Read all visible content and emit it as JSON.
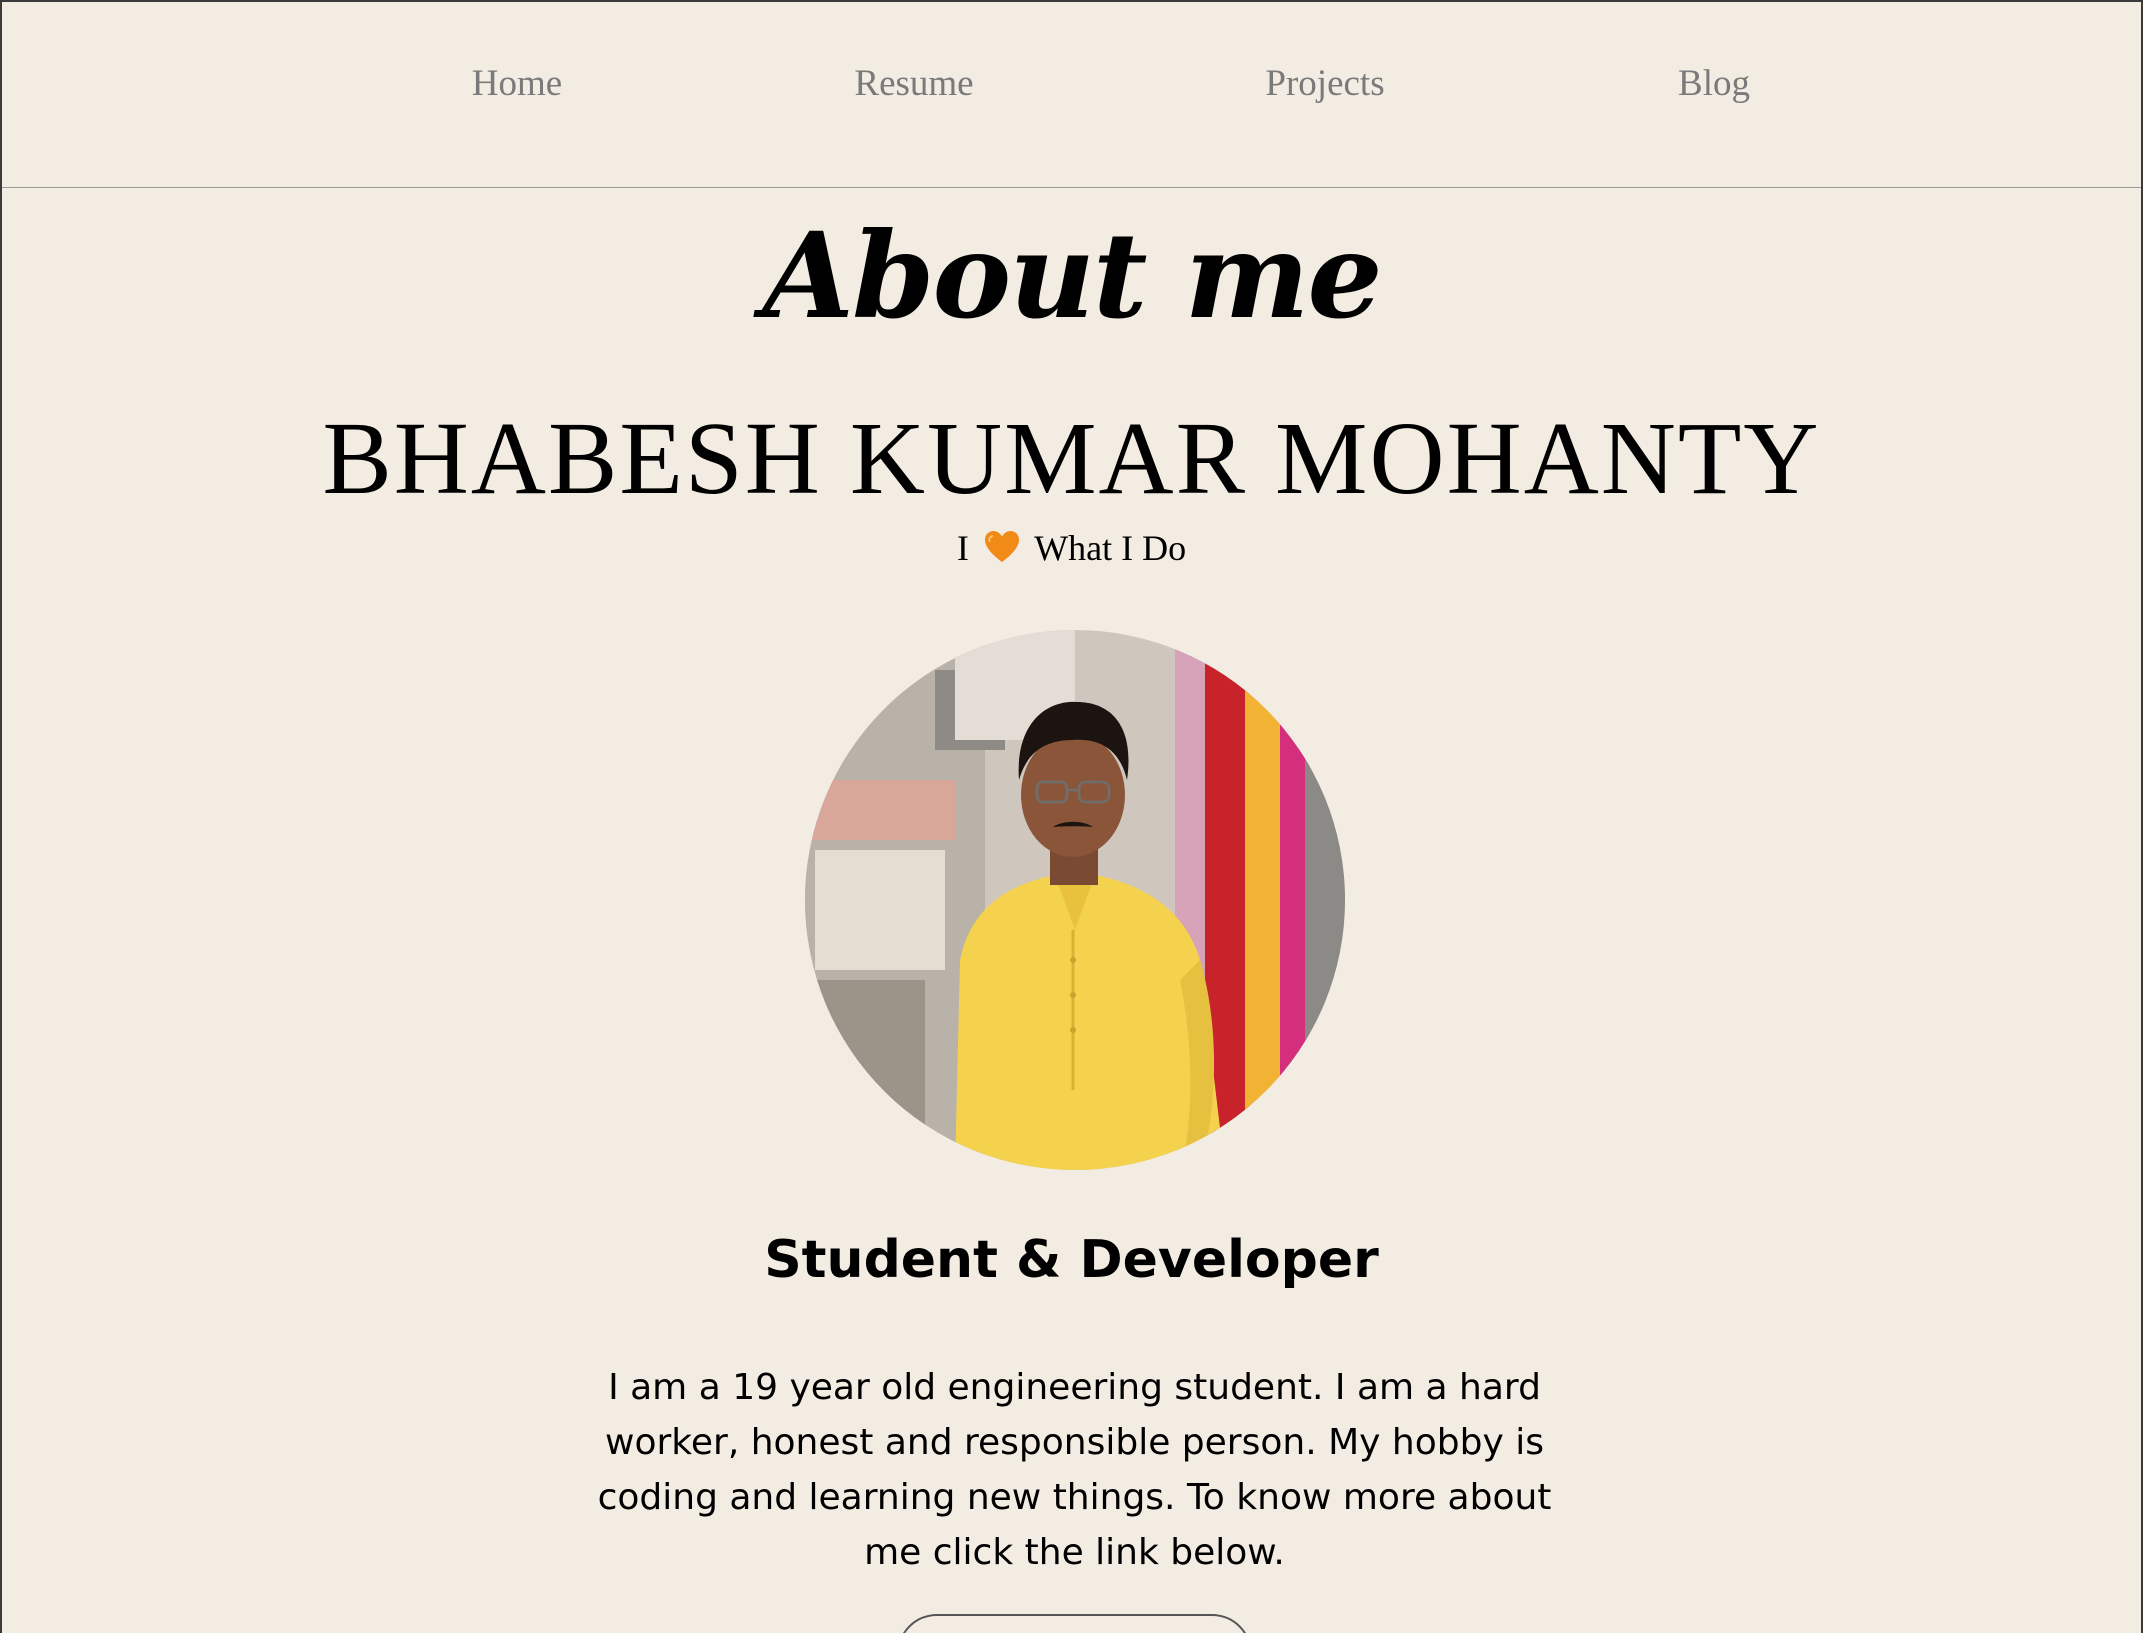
{
  "nav": {
    "items": [
      {
        "label": "Home"
      },
      {
        "label": "Resume"
      },
      {
        "label": "Projects"
      },
      {
        "label": "Blog"
      }
    ]
  },
  "hero": {
    "title": "About me",
    "name": "BHABESH KUMAR MOHANTY",
    "tagline_before": "I",
    "tagline_icon": "orange-heart-icon",
    "tagline_after": "What I Do"
  },
  "profile": {
    "photo": "profile-photo"
  },
  "about": {
    "role": "Student & Developer",
    "bio": "I am a 19 year old engineering student. I am a hard worker, honest and responsible person. My hobby is coding and learning new things. To know more about me click the link below."
  },
  "colors": {
    "background": "#f2ece3",
    "nav_text": "#7a7a7a",
    "heart": "#f28a17",
    "text": "#000000"
  }
}
